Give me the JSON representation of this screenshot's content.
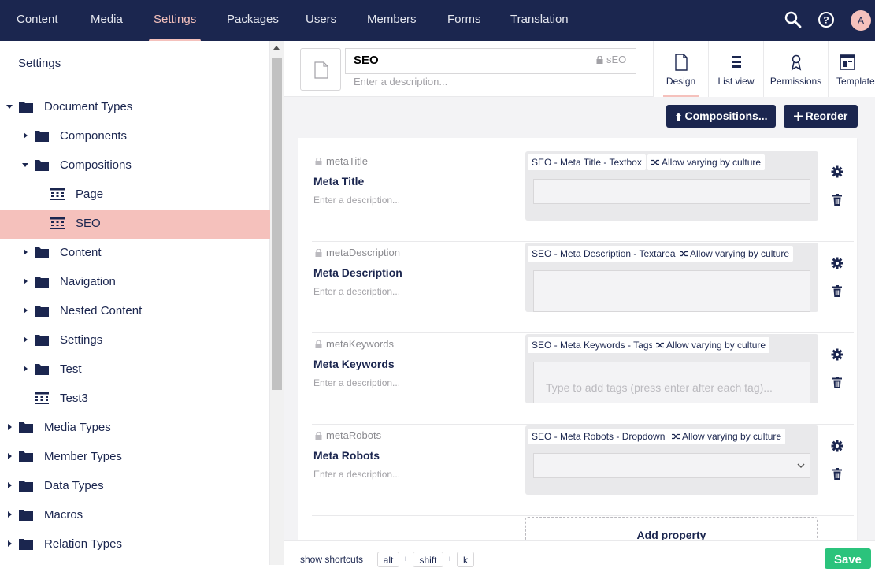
{
  "topnav": {
    "sections": [
      "Content",
      "Media",
      "Settings",
      "Packages",
      "Users",
      "Members",
      "Forms",
      "Translation"
    ],
    "active_section": "Settings",
    "avatar_initial": "A"
  },
  "sidebar": {
    "title": "Settings",
    "items": [
      {
        "label": "Document Types",
        "icon": "folder-icon",
        "caret": "down"
      },
      {
        "label": "Components",
        "icon": "folder-icon",
        "caret": "right"
      },
      {
        "label": "Compositions",
        "icon": "folder-icon",
        "caret": "down"
      },
      {
        "label": "Page",
        "icon": "doctype-icon",
        "caret": "none"
      },
      {
        "label": "SEO",
        "icon": "doctype-icon",
        "caret": "none",
        "active": true
      },
      {
        "label": "Content",
        "icon": "folder-icon",
        "caret": "right"
      },
      {
        "label": "Navigation",
        "icon": "folder-icon",
        "caret": "right"
      },
      {
        "label": "Nested Content",
        "icon": "folder-icon",
        "caret": "right"
      },
      {
        "label": "Settings",
        "icon": "folder-icon",
        "caret": "right"
      },
      {
        "label": "Test",
        "icon": "folder-icon",
        "caret": "right"
      },
      {
        "label": "Test3",
        "icon": "doctype-icon",
        "caret": "none"
      },
      {
        "label": "Media Types",
        "icon": "folder-icon",
        "caret": "right"
      },
      {
        "label": "Member Types",
        "icon": "folder-icon",
        "caret": "right"
      },
      {
        "label": "Data Types",
        "icon": "folder-icon",
        "caret": "right"
      },
      {
        "label": "Macros",
        "icon": "folder-icon",
        "caret": "right"
      },
      {
        "label": "Relation Types",
        "icon": "folder-icon",
        "caret": "right"
      }
    ]
  },
  "editor": {
    "name": "SEO",
    "alias": "sEO",
    "description_placeholder": "Enter a description...",
    "apps": [
      {
        "label": "Design",
        "icon": "document-icon",
        "active": true
      },
      {
        "label": "List view",
        "icon": "list-icon"
      },
      {
        "label": "Permissions",
        "icon": "permissions-icon"
      },
      {
        "label": "Templates",
        "icon": "templates-icon"
      }
    ],
    "compositions_label": "Compositions...",
    "reorder_label": "Reorder",
    "properties": [
      {
        "alias": "metaTitle",
        "name": "Meta Title",
        "description": "Enter a description...",
        "editor_tag": "SEO - Meta Title - Textbox",
        "vary_tag": "Allow varying by culture",
        "kind": "textbox"
      },
      {
        "alias": "metaDescription",
        "name": "Meta Description",
        "description": "Enter a description...",
        "editor_tag": "SEO - Meta Description - Textarea",
        "vary_tag": "Allow varying by culture",
        "kind": "textarea"
      },
      {
        "alias": "metaKeywords",
        "name": "Meta Keywords",
        "description": "Enter a description...",
        "editor_tag": "SEO - Meta Keywords - Tags",
        "vary_tag": "Allow varying by culture",
        "kind": "tags",
        "placeholder": "Type to add tags (press enter after each tag)..."
      },
      {
        "alias": "metaRobots",
        "name": "Meta Robots",
        "description": "Enter a description...",
        "editor_tag": "SEO - Meta Robots - Dropdown",
        "vary_tag": "Allow varying by culture",
        "kind": "dropdown"
      }
    ],
    "add_property_label": "Add property"
  },
  "footer": {
    "shortcuts_label": "show shortcuts",
    "keys": [
      "alt",
      "shift",
      "k"
    ],
    "save_label": "Save"
  },
  "colors": {
    "nav": "#1b264f",
    "accent": "#f5c1bc",
    "save": "#2bc37c"
  }
}
